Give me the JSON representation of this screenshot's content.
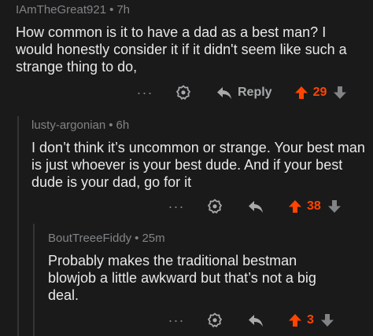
{
  "comments": [
    {
      "author": "IAmTheGreat921",
      "age": "7h",
      "text": "How common is it to have a dad as a best man? I would honestly consider it if it didn't seem like such a strange thing to do,",
      "more": "···",
      "reply_label": "Reply",
      "score": "29"
    },
    {
      "author": "lusty-argonian",
      "age": "6h",
      "text": "I don’t think it’s uncommon or strange. Your best man is just whoever is your best dude. And if your best dude is your dad, go for it",
      "more": "···",
      "score": "38"
    },
    {
      "author": "BoutTreeeFiddy",
      "age": "25m",
      "text": "Probably makes the traditional bestman blowjob a little awkward but that’s not a big deal.",
      "more": "···",
      "score": "3"
    }
  ],
  "colors": {
    "upvote": "#ff4500",
    "muted": "#818384",
    "background": "#1a1a1b"
  },
  "icons": {
    "more": "more-options-icon",
    "award": "award-icon",
    "reply": "reply-arrow-icon",
    "upvote": "upvote-arrow-icon",
    "downvote": "downvote-arrow-icon"
  }
}
